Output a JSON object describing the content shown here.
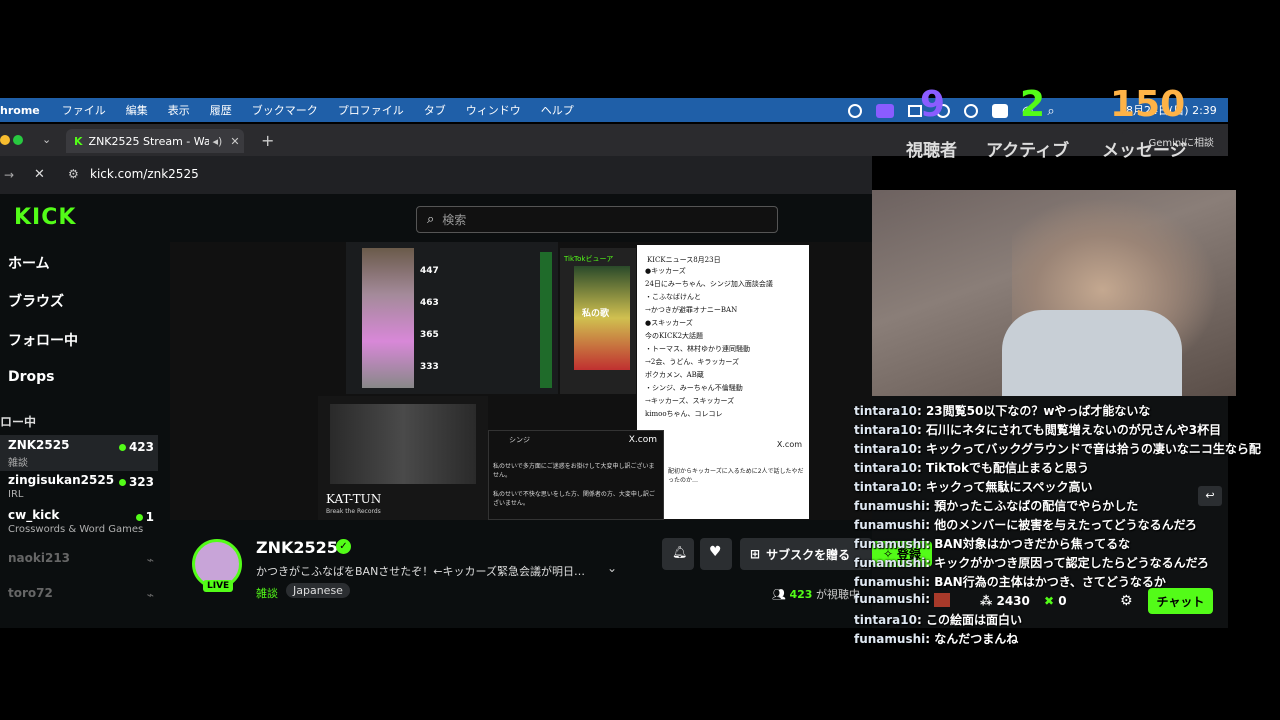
{
  "menubar": {
    "app": "hrome",
    "items": [
      "ファイル",
      "編集",
      "表示",
      "履歴",
      "ブックマーク",
      "プロファイル",
      "タブ",
      "ウィンドウ",
      "ヘルプ"
    ],
    "clock": "8月24日(日)  2:39"
  },
  "stats_overlay": {
    "viewers_value": "9",
    "active_value": "2",
    "messages_value": "150",
    "viewers_label": "視聴者",
    "active_label": "アクティブ",
    "messages_label": "メッセージ"
  },
  "gemini_label": "Geminiに相談",
  "browser": {
    "tab_title": "ZNK2525 Stream - Watch",
    "url": "kick.com/znk2525"
  },
  "kick": {
    "logo": "KICK",
    "search_placeholder": "検索",
    "nav": [
      "ホーム",
      "ブラウズ",
      "フォロー中",
      "Drops"
    ],
    "following_header": "ロー中",
    "channels": [
      {
        "name": "ZNK2525",
        "sub": "雑談",
        "count": "423",
        "live": true
      },
      {
        "name": "zingisukan2525",
        "sub": "IRL",
        "count": "323",
        "live": true
      },
      {
        "name": "cw_kick",
        "sub": "Crosswords & Word Games",
        "count": "1",
        "live": true
      },
      {
        "name": "naoki213",
        "sub": "",
        "count": "",
        "live": false
      },
      {
        "name": "toro72",
        "sub": "",
        "count": "",
        "live": false
      }
    ],
    "streamer": {
      "name": "ZNK2525",
      "title": "かつきがこふなばをBANさせたぞ！←キッカーズ緊急会議が明日…",
      "category": "雑談",
      "tag": "Japanese",
      "live_badge": "LIVE",
      "subscribe_label": "サブスクを贈る",
      "viewers": "423",
      "viewers_suffix": "が視聴中",
      "register_label": "登録"
    },
    "chat_footer": {
      "points": "2430",
      "kick_points": "0",
      "chat_button": "チャット"
    }
  },
  "stream_content": {
    "news_title": "KICKニュース8月23日",
    "news_lines": [
      "●キッカーズ",
      "24日にみーちゃん、シンジ加入面談会議",
      "・こふなばけんと",
      "→かつきが避罪オナニーBAN",
      "●スキッカーズ",
      "今のKICK2大話題",
      "・トーマス、林村ゆかり連同騒動",
      "→2会、うどん、キラッカーズ",
      "ポクカメン、AB蔵",
      "・シンジ、みーちゃん不倫騒動",
      "→キッカーズ、スキッカーズ",
      "kimooちゃん、コレコレ"
    ],
    "tiktok_label": "TikTokビューア",
    "song_label": "私の歌",
    "xcom": "X.com",
    "tweet_user": "シンジ",
    "tweet_text1": "私のせいで多方面にご迷惑をお掛けして大変申し訳ございません。",
    "tweet_text2": "私のせいで不快な思いをした方、関係者の方、大変申し訳ございません。",
    "tweet2_text": "配初からキッカーズに入るために2人で話したやだったのか…",
    "album_text": "KAT-TUN",
    "album_sub": "Break the Records",
    "mini_counts": [
      "447",
      "463",
      "365",
      "333"
    ]
  },
  "chat": [
    {
      "user": "tintara10",
      "msg": "23閲覧50以下なの？wやっぱ才能ないな"
    },
    {
      "user": "tintara10",
      "msg": "石川にネタにされても閲覧増えないのが兄さんや3杯目"
    },
    {
      "user": "tintara10",
      "msg": "キックってバックグラウンドで音は拾うの凄いなニコ生なら配"
    },
    {
      "user": "tintara10",
      "msg": "TikTokでも配信止まると思う"
    },
    {
      "user": "tintara10",
      "msg": "キックって無駄にスペック高い"
    },
    {
      "user": "funamushi",
      "msg": "預かったこふなばの配信でやらかした"
    },
    {
      "user": "funamushi",
      "msg": "他のメンバーに被害を与えたってどうなるんだろ"
    },
    {
      "user": "funamushi",
      "msg": "BAN対象はかつきだから焦ってるな"
    },
    {
      "user": "funamushi",
      "msg": "キックがかつき原因って認定したらどうなるんだろ"
    },
    {
      "user": "funamushi",
      "msg": "BAN行為の主体はかつき、さてどうなるか"
    },
    {
      "user": "funamushi",
      "msg": ""
    },
    {
      "user": "tintara10",
      "msg": "この絵面は面白い"
    },
    {
      "user": "funamushi",
      "msg": "なんだつまんね"
    }
  ],
  "colors": {
    "kick_green": "#53fc18",
    "menubar": "#1f5fa8",
    "counter_purple": "#8a5cff",
    "counter_green": "#53fc18",
    "counter_orange": "#ffb347"
  }
}
